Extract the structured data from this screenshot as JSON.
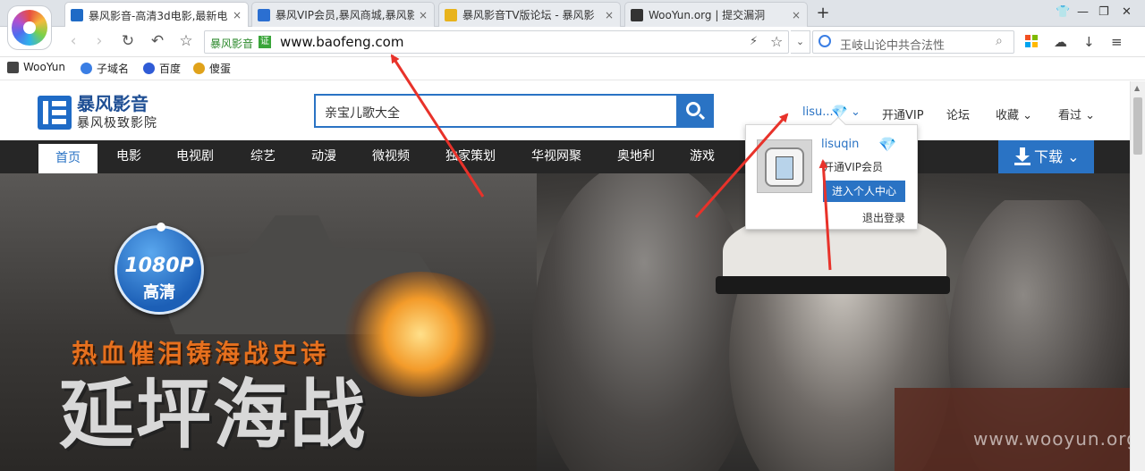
{
  "tabs": [
    {
      "title": "暴风影音-高清3d电影,最新电",
      "favicon": "film-icon",
      "color": "#1f6bc6"
    },
    {
      "title": "暴风VIP会员,暴风商城,暴风影",
      "favicon": "page-icon",
      "color": "#2b6fd1"
    },
    {
      "title": "暴风影音TV版论坛 - 暴风影",
      "favicon": "trophy-icon",
      "color": "#e8b31c"
    },
    {
      "title": "WooYun.org | 提交漏洞",
      "favicon": "wooyun-icon",
      "color": "#333333"
    }
  ],
  "tab_close": "×",
  "new_tab": "+",
  "window": {
    "min": "—",
    "max": "❐",
    "close": "✕",
    "skin": "👕"
  },
  "nav": {
    "back": "‹",
    "forward": "›",
    "reload": "↻",
    "undo": "↶",
    "bookmark": "☆"
  },
  "address": {
    "site_tag": "暴风影音",
    "cert": "证",
    "url": "www.baofeng.com"
  },
  "search": {
    "text": "王岐山论中共合法性"
  },
  "right_tools": {
    "cloud": "☁",
    "download": "↓",
    "menu": "≡"
  },
  "bookmarks": [
    {
      "label": "WooYun",
      "icon": "wooyun-icon",
      "color": "#444444"
    },
    {
      "label": "子域名",
      "icon": "subdomain-icon",
      "color": "#3a7ee4"
    },
    {
      "label": "百度",
      "icon": "baidu-paw-icon",
      "color": "#2f5bd6"
    },
    {
      "label": "傻蛋",
      "icon": "egg-icon",
      "color": "#e0a21a"
    }
  ],
  "site": {
    "logo_name": "暴风影音",
    "logo_slogan": "暴风极致影院",
    "search_text": "亲宝儿歌大全",
    "user_short": "lisu...",
    "links": {
      "vip": "开通VIP",
      "forum": "论坛",
      "favorites": "收藏 ⌄",
      "history": "看过 ⌄"
    },
    "nav_items": [
      "首页",
      "电影",
      "电视剧",
      "综艺",
      "动漫",
      "微视频",
      "独家策划",
      "华视网聚",
      "奥地利",
      "游戏"
    ],
    "download": "下载 ⌄"
  },
  "hero": {
    "badge_res": "1080P",
    "badge_hd": "高清",
    "tagline": "热血催泪铸海战史诗",
    "title": "延坪海战",
    "watermark": "www.wooyun.org"
  },
  "popup": {
    "username": "lisuqin",
    "vip_text": "开通VIP会员",
    "center_btn": "进入个人中心",
    "logout": "退出登录"
  },
  "colors": {
    "accent": "#2a73c4",
    "arrow": "#e8322a",
    "nav_bg": "#262626"
  }
}
